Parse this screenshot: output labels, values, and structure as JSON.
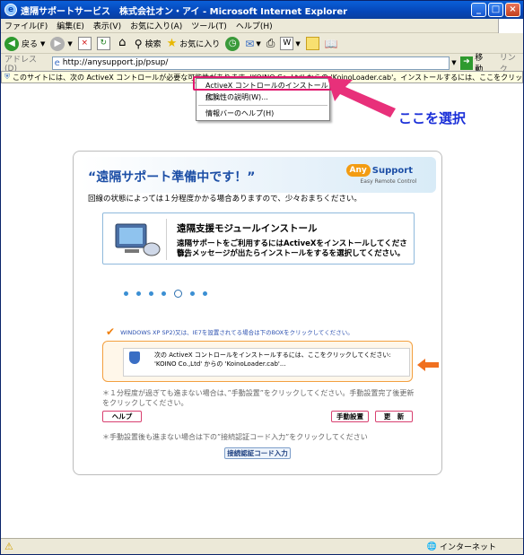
{
  "window": {
    "title": "遠隔サポートサービス　株式会社オン・アイ - Microsoft Internet Explorer",
    "menu": [
      "ファイル(F)",
      "編集(E)",
      "表示(V)",
      "お気に入り(A)",
      "ツール(T)",
      "ヘルプ(H)"
    ],
    "toolbar": {
      "back": "戻る",
      "search": "検索",
      "favorites": "お気に入り"
    },
    "address_label": "アドレス(D)",
    "address_value": "http://anysupport.jp/psup/",
    "go_label": "移動",
    "links_label": "リンク"
  },
  "infobar": {
    "text": "このサイトには、次の ActiveX コントロールが必要な可能性があります: 'KOINO Co.,Ltd' からの 'KoinoLoader.cab'。インストールするには、ここをクリックしてください..."
  },
  "context_menu": {
    "items": [
      "ActiveX コントロールのインストール(C)...",
      "危険性の説明(W)...",
      "情報バーのヘルプ(H)"
    ]
  },
  "callout": "ここを選択",
  "page": {
    "header_title": "“遠隔サポート準備中です！”",
    "logo_any": "Any",
    "logo_support": "Support",
    "logo_sub": "Easy Remote Control",
    "desc": "回線の状態によっては１分程度かかる場合ありますので、少々おまちください。",
    "module_title": "遠隔支援モジュールインストール",
    "module_line1": "遠隔サポートをご利用するにはActiveXをインストールしてください。",
    "module_line2": "警告メッセージが出たらインストールをするを選択してください。",
    "winxp_note": "WINDOWS XP SP2)又は、IE7を設置されてる場合は下のBOXをクリックしてください。",
    "infobar_copy": "次の ActiveX コントロールをインストールするには、ここをクリックしてください: 'KOINO Co.,Ltd' からの 'KoinoLoader.cab'...",
    "note1": "＊１分程度が過ぎても進まない場合は、”手動設置”をクリックしてください。手動設置完了後更新をクリックしてください。",
    "help_btn": "ヘルプ",
    "manual_btn": "手動設置",
    "refresh_btn": "更　新",
    "note2": "＊手動設置後も進まない場合は下の”接続認証コード入力”をクリックしてください",
    "code_btn": "接続認証コード入力"
  },
  "status": {
    "zone": "インターネット"
  }
}
